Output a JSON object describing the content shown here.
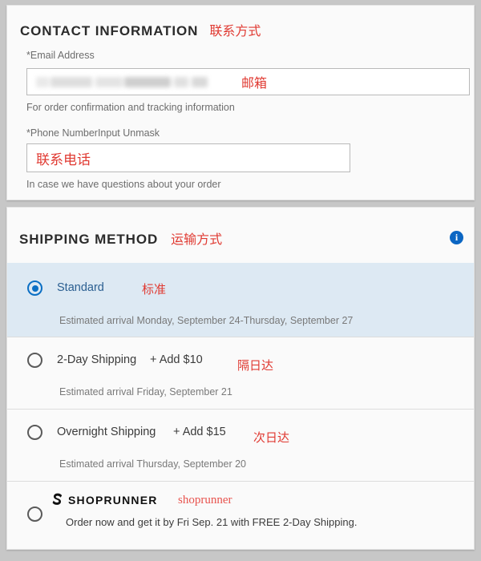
{
  "contact": {
    "title": "CONTACT INFORMATION",
    "title_cn": "联系方式",
    "email": {
      "label": "*Email Address",
      "value": "",
      "value_cn": "邮箱",
      "help": "For order confirmation and tracking information",
      "redacted": true
    },
    "phone": {
      "label": "*Phone NumberInput Unmask",
      "value": "联系电话",
      "placeholder": "",
      "help": "In case we have questions about your order"
    }
  },
  "shipping": {
    "title": "SHIPPING METHOD",
    "title_cn": "运输方式",
    "info_icon": "info-icon",
    "info_glyph": "i",
    "options": [
      {
        "name": "Standard",
        "price": "",
        "eta": "Estimated arrival Monday, September 24-Thursday, September 27",
        "cn": "标准",
        "selected": true
      },
      {
        "name": "2-Day Shipping",
        "price": "+ Add $10",
        "eta": "Estimated arrival Friday, September 21",
        "cn": "隔日达",
        "selected": false
      },
      {
        "name": "Overnight Shipping",
        "price": "+ Add $15",
        "eta": "Estimated arrival Thursday, September 20",
        "cn": "次日达",
        "selected": false
      }
    ],
    "shoprunner": {
      "logo_icon": "shoprunner-swirl-icon",
      "wordmark": "SHOPRUNNER",
      "cn": "shoprunner",
      "description": "Order now and get it by Fri Sep. 21 with FREE 2-Day Shipping.",
      "selected": false
    }
  },
  "colors": {
    "accent_blue": "#0b6fc4",
    "selected_row": "#dde9f3",
    "annotation_red": "#e03a32",
    "card_bg": "#fafafa",
    "page_bg": "#c7c7c7"
  }
}
